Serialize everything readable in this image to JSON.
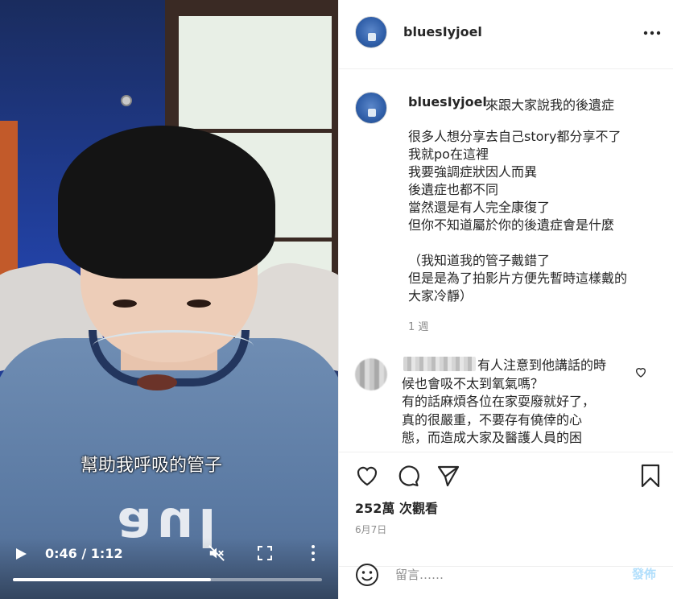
{
  "video": {
    "subtitle": "幫助我呼吸的管子",
    "jersey_text": "aul",
    "time": "0:46 / 1:12",
    "progress": 0.64,
    "icons": [
      "play-icon",
      "muted-speaker-icon",
      "fullscreen-icon",
      "more-vertical-icon"
    ]
  },
  "header": {
    "username": "bluesIyjoel",
    "more_icon": "more-horizontal-icon"
  },
  "caption": {
    "username": "bluesIyjoel",
    "title": "來跟大家說我的後遺症",
    "lines": [
      "很多人想分享去自己story都分享不了",
      "我就po在這裡",
      "我要強調症狀因人而異",
      "後遺症也都不同",
      "當然還是有人完全康復了",
      "但你不知道屬於你的後遺症會是什麼"
    ],
    "lines2": [
      "（我知道我的管子戴錯了",
      "但是是為了拍影片方便先暫時這樣戴的",
      "大家冷靜）"
    ],
    "meta": "1 週"
  },
  "comment": {
    "lines": [
      "有人注意到他講話的時",
      "候也會吸不太到氧氣嗎？",
      "有的話麻煩各位在家耍廢就好了，",
      "真的很嚴重，不要存有僥倖的心",
      "態，而造成大家及醫護人員的困"
    ]
  },
  "actions": {
    "views": "252萬 次觀看",
    "date": "6月7日"
  },
  "compose": {
    "placeholder": "留言……",
    "post_label": "發佈"
  },
  "colors": {
    "text": "#262626",
    "secondary": "#8e8e8e",
    "post_disabled": "#b2dffc",
    "divider": "#efefef"
  }
}
